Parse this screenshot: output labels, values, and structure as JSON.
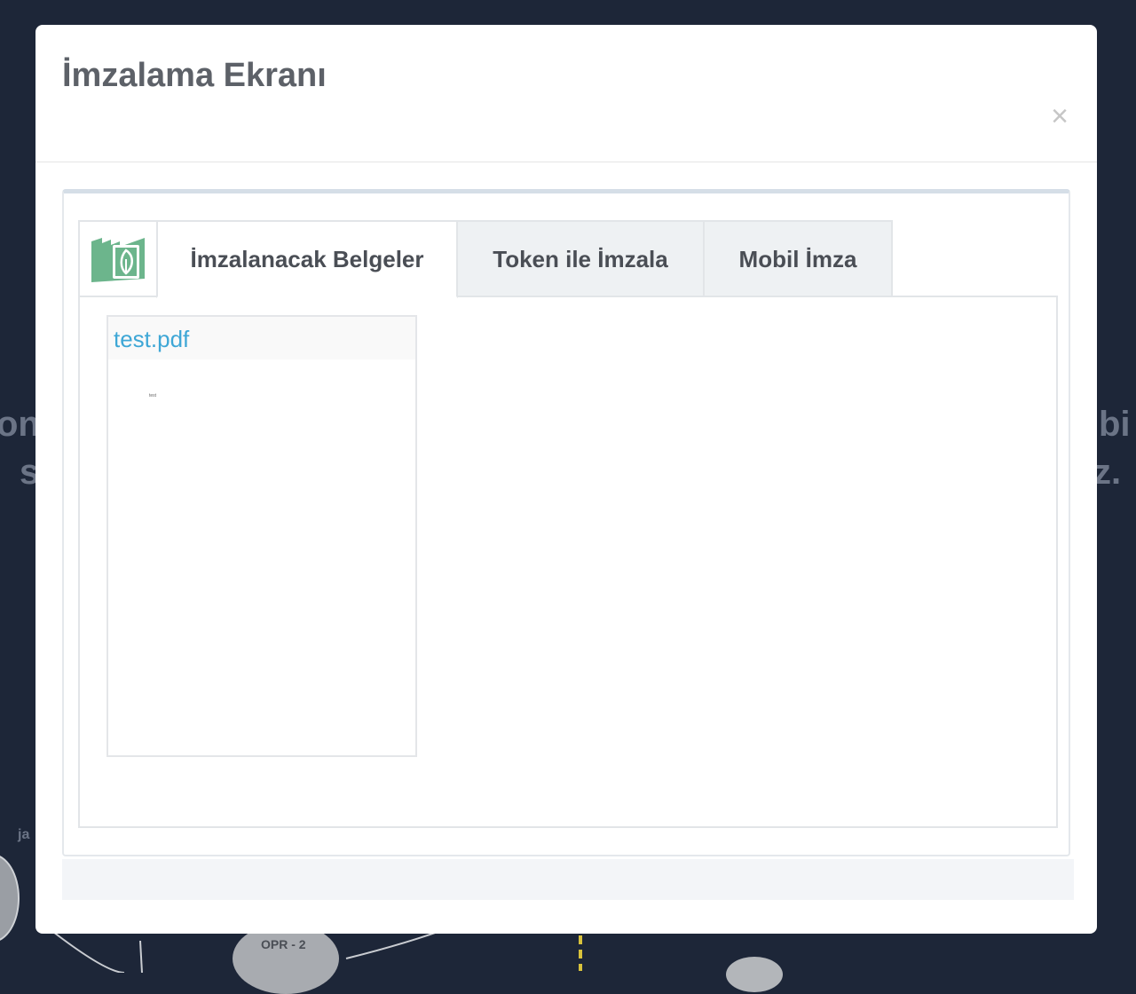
{
  "background": {
    "line1_left": "oni",
    "line2_left": "s",
    "line1_right": "bi",
    "line2_right": "z.",
    "small_label": "ja",
    "node_label": "OPR - 2"
  },
  "modal": {
    "title": "İmzalama Ekranı",
    "close_label": "×"
  },
  "tabs": [
    {
      "label": "İmzalanacak Belgeler",
      "active": true
    },
    {
      "label": "Token ile İmzala",
      "active": false
    },
    {
      "label": "Mobil İmza",
      "active": false
    }
  ],
  "logo": {
    "icon": "document-leaf-icon",
    "color": "#6cb58c"
  },
  "documents": [
    {
      "name": "test.pdf",
      "preview_text": "test"
    }
  ],
  "colors": {
    "link": "#3ea7d6",
    "backdrop": "#1d2638",
    "tab_inactive_bg": "#eef1f3"
  }
}
